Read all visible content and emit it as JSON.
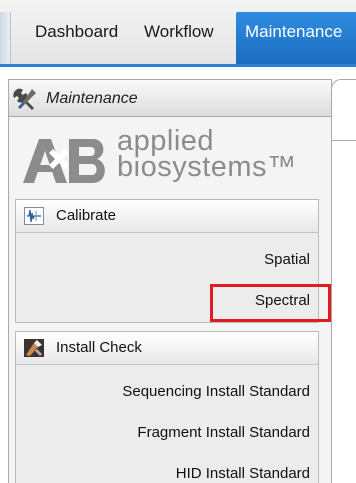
{
  "tabs": [
    {
      "label": "Dashboard",
      "active": false
    },
    {
      "label": "Workflow",
      "active": false
    },
    {
      "label": "Maintenance",
      "active": true
    }
  ],
  "panel": {
    "title": "Maintenance",
    "icon": "wrench-icon"
  },
  "logo": {
    "mark_text": "A B",
    "line1": "applied",
    "line2": "biosystems™"
  },
  "sections": [
    {
      "label": "Calibrate",
      "icon": "calibrate-waveform-icon",
      "items": [
        "Spatial",
        "Spectral"
      ]
    },
    {
      "label": "Install Check",
      "icon": "install-check-icon",
      "items": [
        "Sequencing Install Standard",
        "Fragment Install Standard",
        "HID Install Standard"
      ]
    }
  ],
  "highlighted_item": "Spectral",
  "colors": {
    "active_tab": "#1b6dc0",
    "highlight": "#e21a22",
    "logo_gray": "#8c8c8c"
  }
}
